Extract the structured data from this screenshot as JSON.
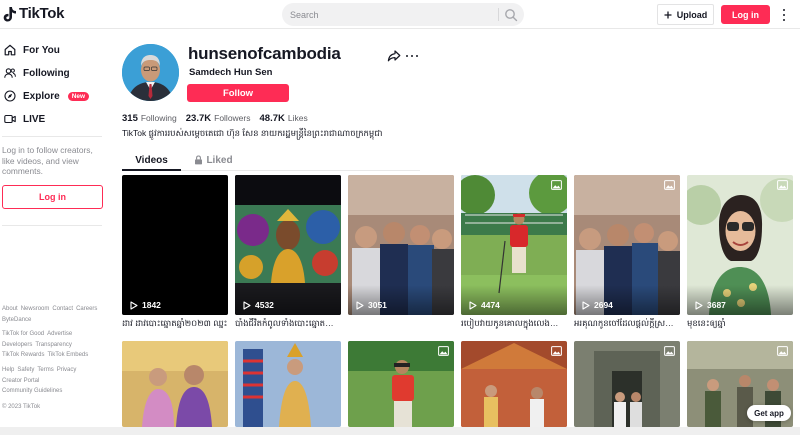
{
  "app": {
    "logo_text": "TikTok",
    "brand_color": "#fe2c55"
  },
  "header": {
    "search_placeholder": "Search",
    "upload_label": "Upload",
    "login_label": "Log in"
  },
  "sidebar": {
    "nav": [
      {
        "label": "For You",
        "icon": "home-icon"
      },
      {
        "label": "Following",
        "icon": "following-icon"
      },
      {
        "label": "Explore",
        "icon": "compass-icon",
        "badge": "New"
      },
      {
        "label": "LIVE",
        "icon": "live-icon"
      }
    ],
    "login_note": "Log in to follow creators, like videos, and view comments.",
    "login_button": "Log in",
    "footer": {
      "row1": [
        "About",
        "Newsroom",
        "Contact",
        "Careers",
        "ByteDance"
      ],
      "row2": [
        "TikTok for Good",
        "Advertise",
        "Developers",
        "Transparency",
        "TikTok Rewards",
        "TikTok Embeds"
      ],
      "row3": [
        "Help",
        "Safety",
        "Terms",
        "Privacy",
        "Creator Portal",
        "Community Guidelines"
      ],
      "copyright": "© 2023 TikTok"
    }
  },
  "profile": {
    "username": "hunsenofcambodia",
    "nickname": "Samdech Hun Sen",
    "follow_label": "Follow",
    "stats": [
      {
        "value": "315",
        "label": "Following"
      },
      {
        "value": "23.7K",
        "label": "Followers"
      },
      {
        "value": "48.7K",
        "label": "Likes"
      }
    ],
    "bio": "TikTok ផ្លូវការរបស់សម្តេចតេជោ ហ៊ុន សែន នាយករដ្ឋមន្ត្រីនៃព្រះរាជាណាចក្រកម្ពុជា"
  },
  "tabs": {
    "videos": "Videos",
    "liked": "Liked"
  },
  "videos": [
    {
      "views": "1842",
      "caption": "ដាវ ដាវបោះឆ្នោតឆ្នាំ២០២៣ ឈ្នះ",
      "photo": false
    },
    {
      "views": "4532",
      "caption": "បាំងជីវិតកំពូលទាំងបោះឆ្នោតថ្ងៃ២...",
      "photo": false
    },
    {
      "views": "3051",
      "caption": "",
      "photo": false
    },
    {
      "views": "4474",
      "caption": "របៀបវាយកូនគោលក្នុងលេងហ្គោលខ្លី",
      "photo": true
    },
    {
      "views": "2694",
      "caption": "អរគុណកូនចៅដែលផ្តល់ក្តីស្រលាញ់...",
      "photo": true
    },
    {
      "views": "3687",
      "caption": "មុខនេះឲ្យឆ្នាំ",
      "photo": true
    },
    {
      "views": "",
      "caption": "",
      "photo": false
    },
    {
      "views": "",
      "caption": "",
      "photo": false
    },
    {
      "views": "",
      "caption": "",
      "photo": true
    },
    {
      "views": "",
      "caption": "",
      "photo": true
    },
    {
      "views": "",
      "caption": "",
      "photo": true
    },
    {
      "views": "",
      "caption": "",
      "photo": true
    }
  ],
  "get_app": "Get app"
}
